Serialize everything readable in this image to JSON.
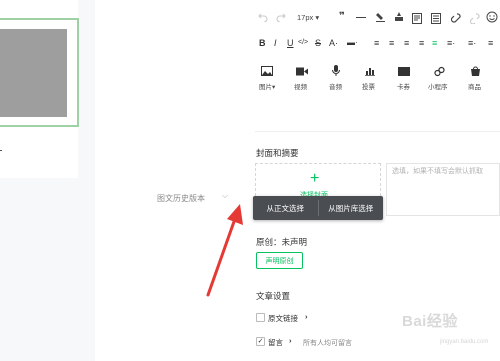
{
  "history": {
    "label": "图文历史版本",
    "chevron": "⌵"
  },
  "toolbar": {
    "font_size": "17px ▾",
    "quote": "❞",
    "row2": [
      "B",
      "I",
      "U",
      "</>",
      "S",
      "A·",
      "▬·",
      "≡",
      "≡",
      "≡",
      "≡",
      "≡",
      "≡·",
      "≡·",
      "≡"
    ],
    "media": [
      {
        "label": "图片▾",
        "icon": "image-icon"
      },
      {
        "label": "视频",
        "icon": "video-icon"
      },
      {
        "label": "音频",
        "icon": "audio-icon"
      },
      {
        "label": "投票",
        "icon": "vote-icon"
      },
      {
        "label": "卡券",
        "icon": "card-icon"
      },
      {
        "label": "小程序",
        "icon": "miniprogram-icon"
      },
      {
        "label": "商品",
        "icon": "goods-icon"
      }
    ]
  },
  "cover": {
    "title": "封面和摘要",
    "plus": "+",
    "partial_text": "选择封面",
    "summary_placeholder": "选填，如果不填写会默认抓取",
    "popup": {
      "from_article": "从正文选择",
      "from_library": "从图片库选择"
    }
  },
  "original": {
    "label": "原创：未声明",
    "button": "声明原创"
  },
  "article_settings": {
    "title": "文章设置",
    "source_link": "原文链接",
    "comments": "留言",
    "comments_value": "所有人均可留言",
    "arrow": "›"
  },
  "watermark": {
    "brand": "Bai经验",
    "sub": "jingyan.baidu.com"
  },
  "colors": {
    "accent": "#07c160",
    "arrow": "#e53935",
    "popup_bg": "#4a4d52",
    "cover_border": "#9fd1a4"
  }
}
